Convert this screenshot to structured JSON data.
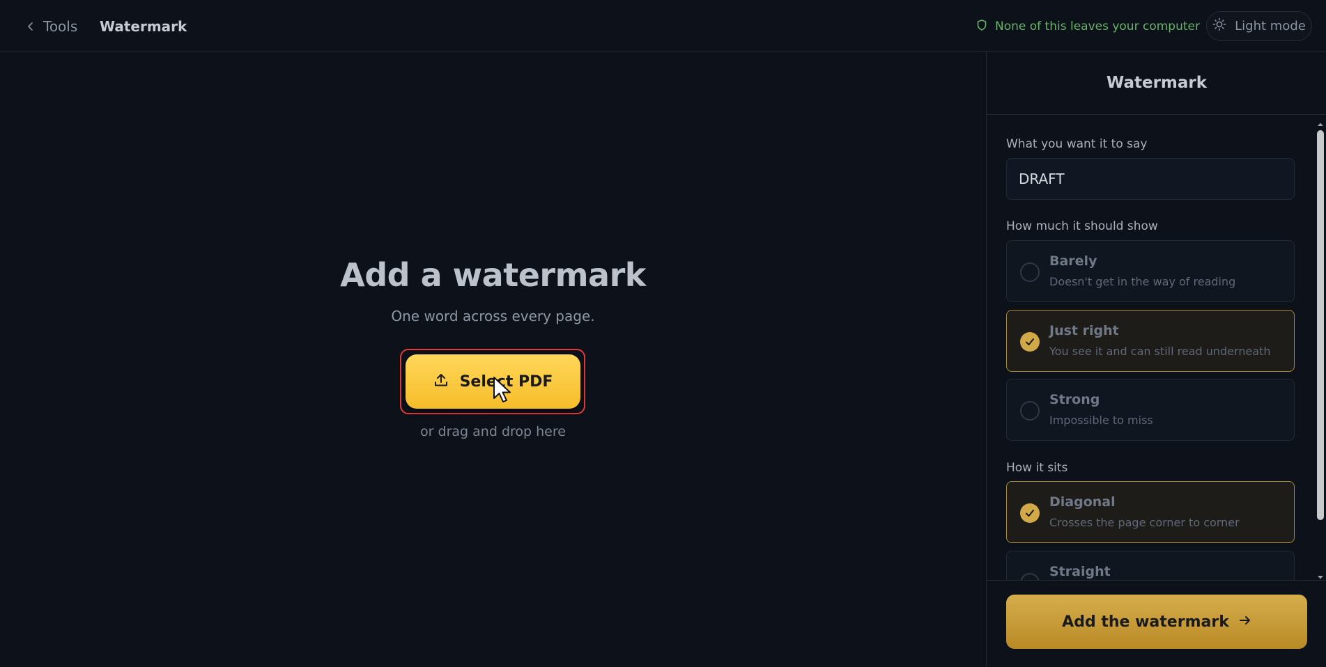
{
  "header": {
    "back_label": "Tools",
    "title": "Watermark",
    "privacy_text": "None of this leaves your computer",
    "theme_toggle_label": "Light mode"
  },
  "main": {
    "title": "Add a watermark",
    "subtitle": "One word across every page.",
    "select_button_label": "Select PDF",
    "drop_hint": "or drag and drop here"
  },
  "sidebar": {
    "title": "Watermark",
    "text_field": {
      "label": "What you want it to say",
      "value": "DRAFT"
    },
    "visibility": {
      "label": "How much it should show",
      "options": [
        {
          "title": "Barely",
          "description": "Doesn't get in the way of reading",
          "selected": false
        },
        {
          "title": "Just right",
          "description": "You see it and can still read underneath",
          "selected": true
        },
        {
          "title": "Strong",
          "description": "Impossible to miss",
          "selected": false
        }
      ]
    },
    "orientation": {
      "label": "How it sits",
      "options": [
        {
          "title": "Diagonal",
          "description": "Crosses the page corner to corner",
          "selected": true
        },
        {
          "title": "Straight",
          "description": "",
          "selected": false
        }
      ]
    },
    "submit_label": "Add the watermark"
  },
  "colors": {
    "background": "#0d1119",
    "accent_yellow": "#f6bd2a",
    "accent_gold": "#d2a949",
    "privacy_green": "#68b36c",
    "highlight_red": "#e23b3b"
  }
}
